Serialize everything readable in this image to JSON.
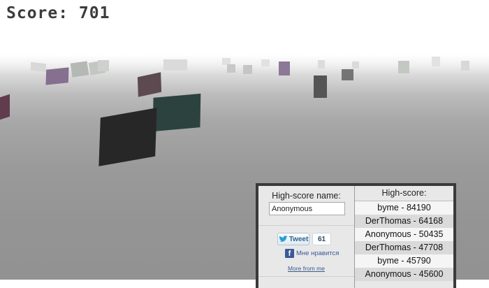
{
  "hud": {
    "score_text": "Score: 701"
  },
  "scene": {
    "cube_colors": {
      "large_black": "#272727",
      "dark_teal": "#2c423f",
      "plum": "#5d4a50",
      "lavender": "#857090",
      "dark_gray": "#555555",
      "light_gray": "#c8c8c8"
    }
  },
  "panel": {
    "name_label": "High-score name:",
    "name_value": "Anonymous",
    "tweet_label": "Tweet",
    "tweet_count": "61",
    "like_label": "Мне нравится",
    "more_link": "More from me",
    "highscore_title": "High-score:",
    "highscores": [
      "byme - 84190",
      "DerThomas - 64168",
      "Anonymous - 50435",
      "DerThomas - 47708",
      "byme - 45790",
      "Anonymous - 45600"
    ]
  }
}
